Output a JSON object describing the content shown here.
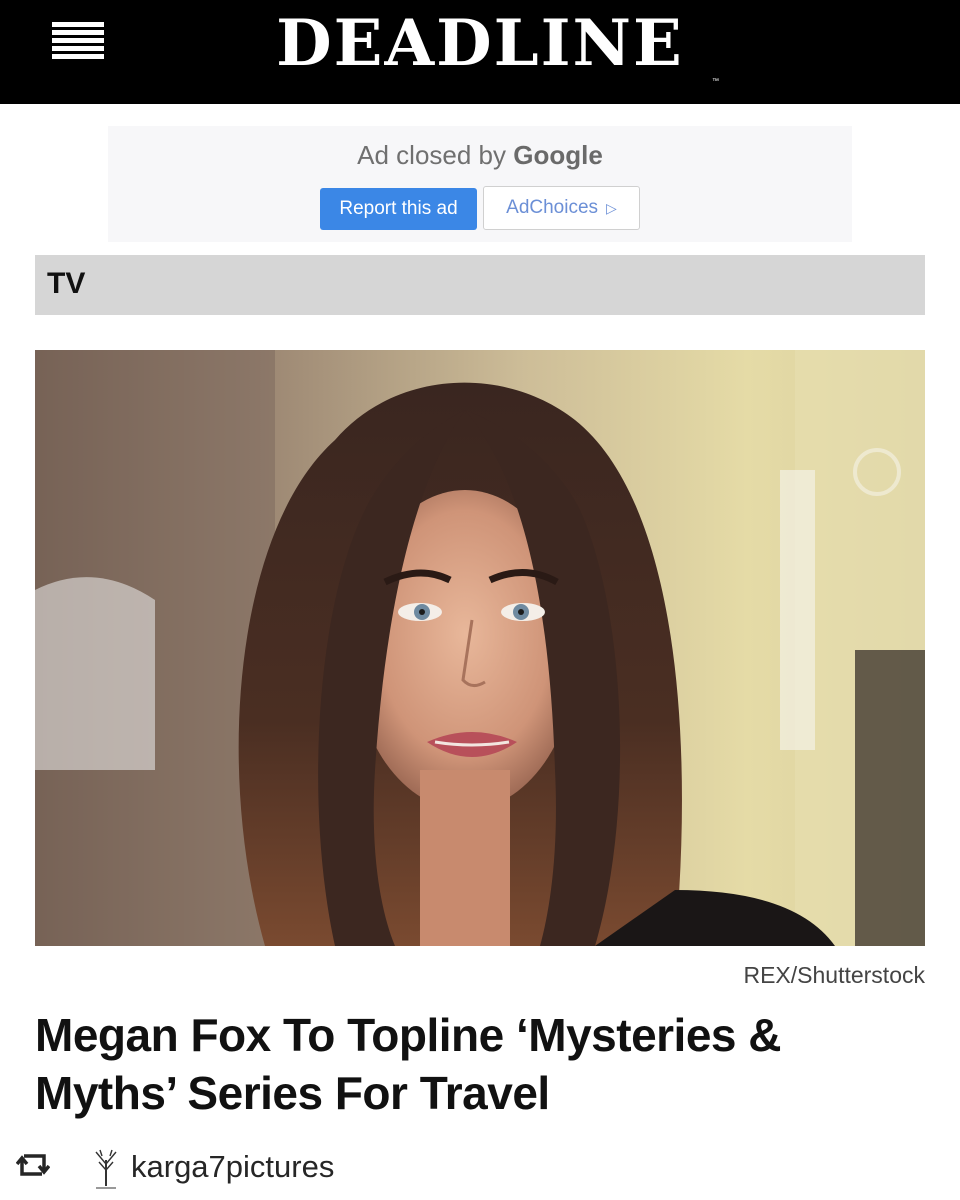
{
  "header": {
    "logo": "DEADLINE",
    "trademark": "™",
    "menu_icon": "hamburger-menu-icon"
  },
  "ad": {
    "closed_prefix": "Ad closed by",
    "closed_brand": "Google",
    "report_label": "Report this ad",
    "adchoices_label": "AdChoices",
    "adchoices_icon": "adchoices-play-icon"
  },
  "section": {
    "label": "TV"
  },
  "article": {
    "image_credit": "REX/Shutterstock",
    "headline": "Megan Fox To Topline ‘Mysteries & Myths’ Series For Travel"
  },
  "repost": {
    "icon": "repost-icon",
    "account": "karga7pictures"
  },
  "colors": {
    "header_bg": "#000000",
    "report_button": "#3b87e6",
    "section_bar": "#d6d6d6"
  }
}
